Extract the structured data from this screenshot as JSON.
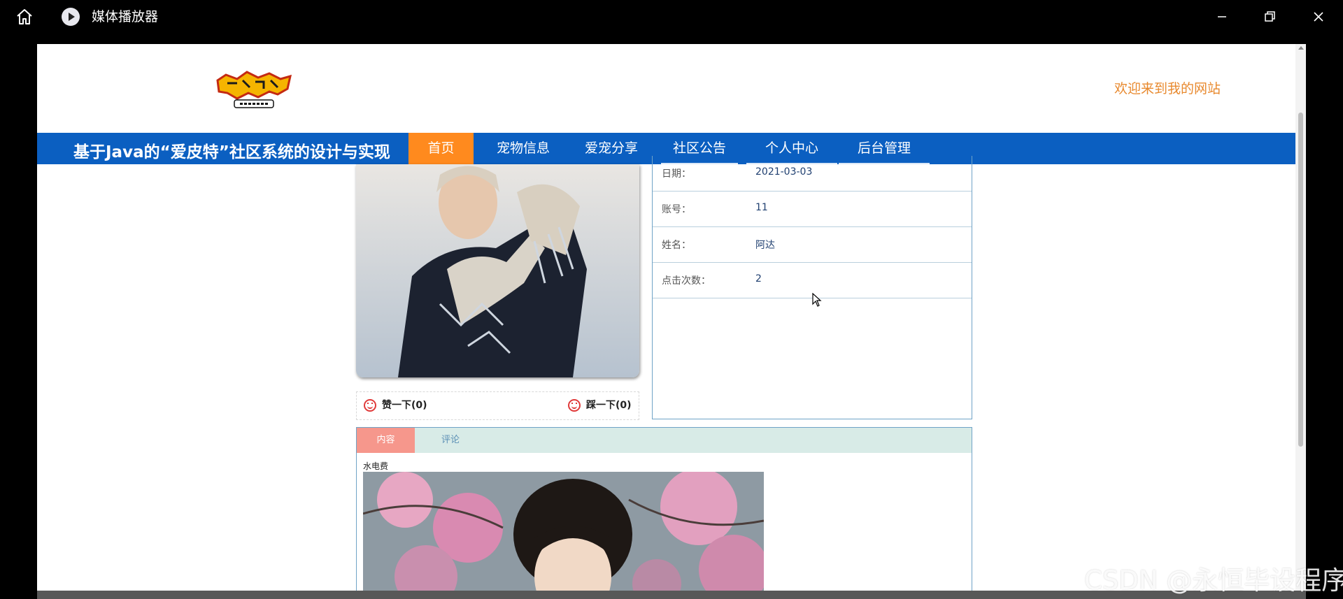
{
  "titlebar": {
    "app_title": "媒体播放器"
  },
  "header": {
    "welcome": "欢迎来到我的网站"
  },
  "nav": {
    "site_title": "基于Java的“爱皮特”社区系统的设计与实现",
    "items": [
      {
        "label": "首页",
        "active": true
      },
      {
        "label": "宠物信息"
      },
      {
        "label": "爱宠分享"
      },
      {
        "label": "社区公告"
      },
      {
        "label": "个人中心"
      },
      {
        "label": "后台管理"
      }
    ]
  },
  "detail": {
    "rows": [
      {
        "label": "日期：",
        "value": "2021-03-03"
      },
      {
        "label": "账号：",
        "value": "11"
      },
      {
        "label": "姓名：",
        "value": "阿达"
      },
      {
        "label": "点击次数：",
        "value": "2"
      }
    ],
    "like_label": "赞一下(0)",
    "dislike_label": "踩一下(0)"
  },
  "tabs": [
    {
      "label": "内容",
      "active": true
    },
    {
      "label": "评论"
    }
  ],
  "content": {
    "text": "水电费"
  },
  "watermark": "CSDN @永恒毕设程序",
  "colors": {
    "nav_bg": "#0b5fc1",
    "nav_active": "#ff8a1e",
    "welcome": "#e8892e",
    "tab_active": "#f6978c",
    "tab_bar": "#d8ebe7"
  }
}
